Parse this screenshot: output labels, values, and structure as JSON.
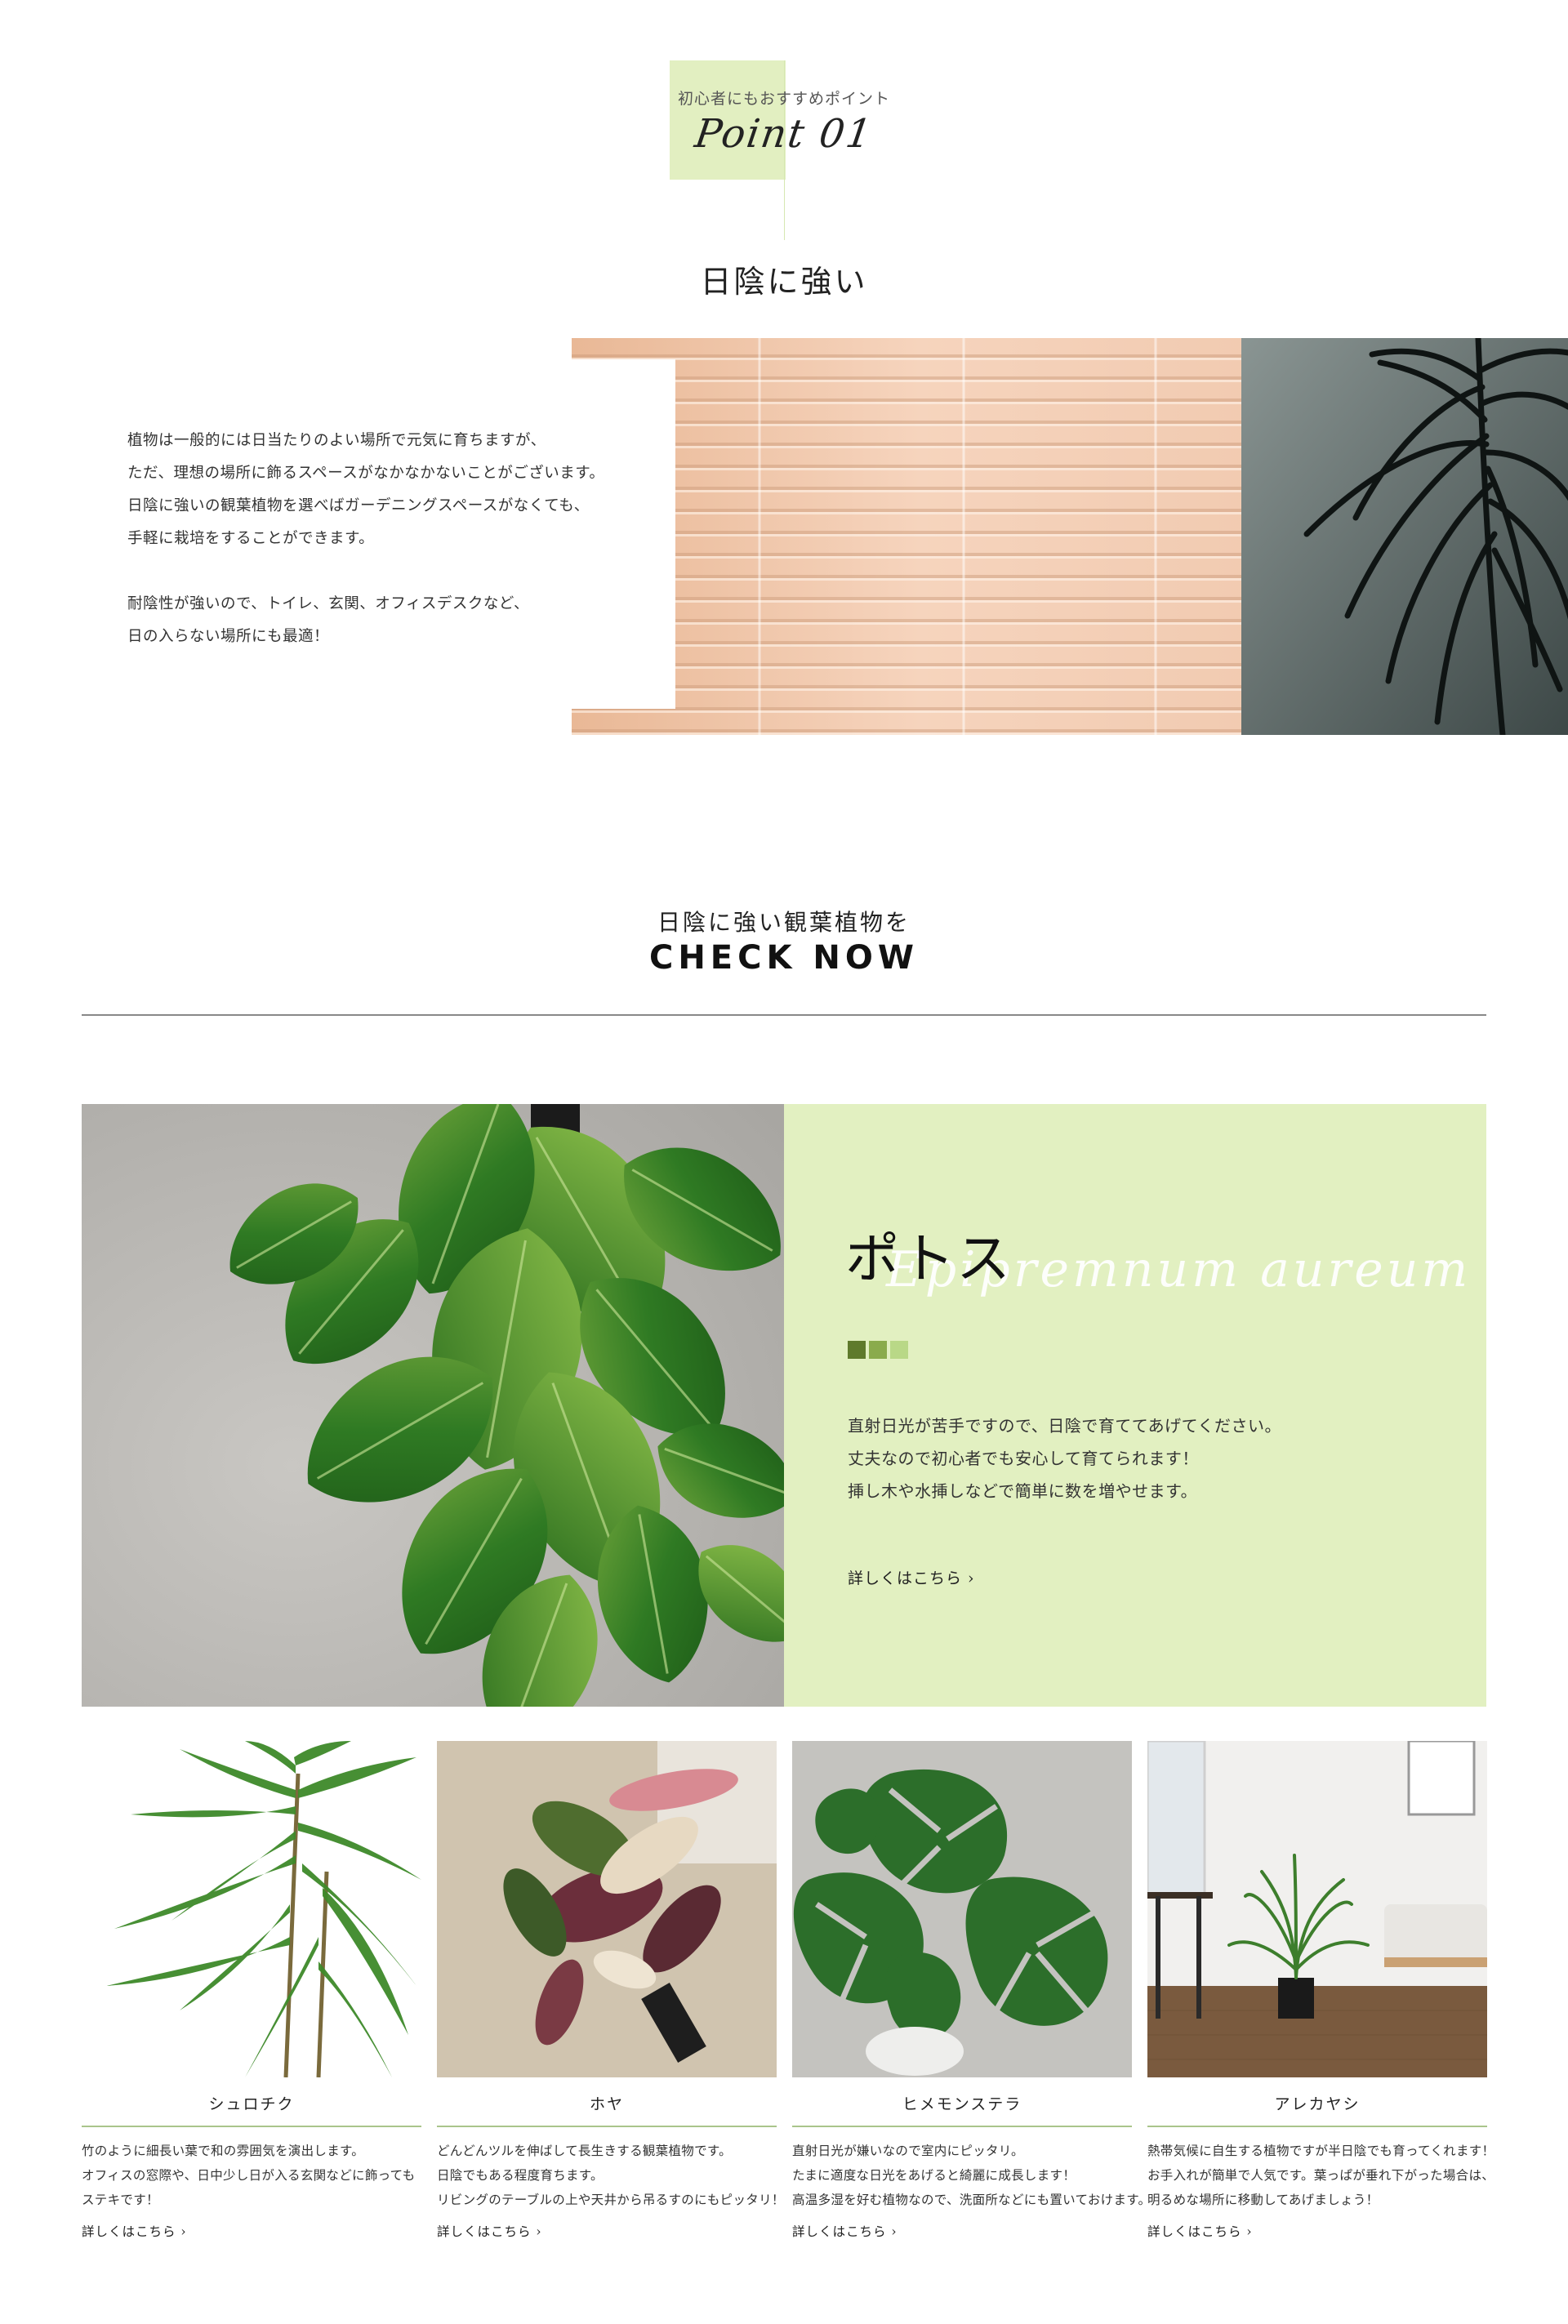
{
  "point": {
    "subtitle": "初心者にもおすすめポイント",
    "label": "Point 01",
    "title": "日陰に強い"
  },
  "intro": {
    "paragraph1": [
      "植物は一般的には日当たりのよい場所で元気に育ちますが、",
      "ただ、理想の場所に飾るスペースがなかなかないことがございます。",
      "日陰に強いの観葉植物を選べばガーデニングスペースがなくても、",
      "手軽に栽培をすることができます。"
    ],
    "paragraph2": [
      "耐陰性が強いので、トイレ、玄関、オフィスデスクなど、",
      "日の入らない場所にも最適！"
    ]
  },
  "check": {
    "heading_jp": "日陰に強い観葉植物を",
    "heading_en": "CHECK NOW"
  },
  "featured": {
    "name": "ポトス",
    "latin": "Epipremnum aureum",
    "swatches": [
      "#5f7a2c",
      "#8aab4c",
      "#b9d887"
    ],
    "description": [
      "直射日光が苦手ですので、日陰で育ててあげてください。",
      "丈夫なので初心者でも安心して育てられます！",
      "挿し木や水挿しなどで簡単に数を増やせます。"
    ],
    "link": "詳しくはこちら ›"
  },
  "cards": [
    {
      "name": "シュロチク",
      "description": [
        "竹のように細長い葉で和の雰囲気を演出します。",
        "オフィスの窓際や、日中少し日が入る玄関などに飾っても",
        "ステキです！"
      ],
      "link": "詳しくはこちら  ›"
    },
    {
      "name": "ホヤ",
      "description": [
        "どんどんツルを伸ばして長生きする観葉植物です。",
        "日陰でもある程度育ちます。",
        "リビングのテーブルの上や天井から吊るすのにもピッタリ！"
      ],
      "link": "詳しくはこちら  ›"
    },
    {
      "name": "ヒメモンステラ",
      "description": [
        "直射日光が嫌いなので室内にピッタリ。",
        "たまに適度な日光をあげると綺麗に成長します！",
        "高温多湿を好む植物なので、洗面所などにも置いておけます。"
      ],
      "link": "詳しくはこちら  ›"
    },
    {
      "name": "アレカヤシ",
      "description": [
        "熱帯気候に自生する植物ですが半日陰でも育ってくれます！",
        "お手入れが簡単で人気です。葉っぱが垂れ下がった場合は、",
        "明るめな場所に移動してあげましょう！"
      ],
      "link": "詳しくはこちら  ›"
    }
  ]
}
